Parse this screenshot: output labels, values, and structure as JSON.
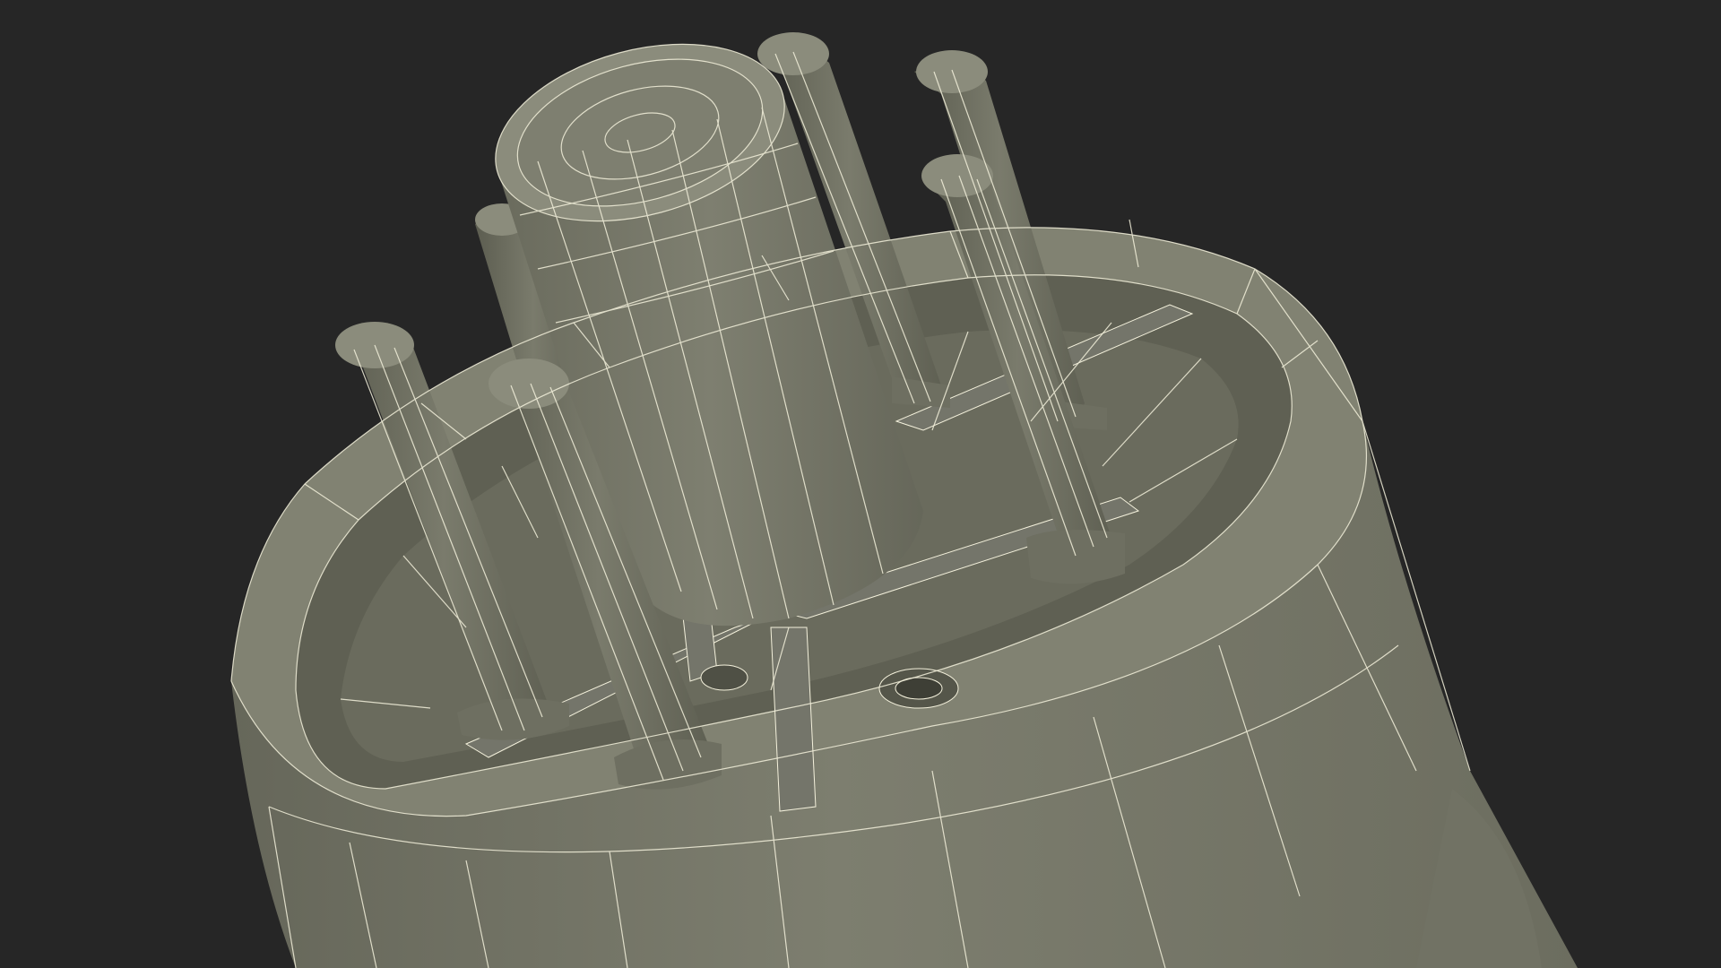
{
  "viewport": {
    "background_color": "#262626",
    "shading_color": "#7a7b6c",
    "shadow_color": "#5a5b4e",
    "highlight_color": "#8b8c7c",
    "wire_color": "#f4f1dc"
  },
  "render": {
    "subject": "wireframe-plug-model",
    "pin_count": 6,
    "display_mode": "shaded-with-wireframe"
  }
}
